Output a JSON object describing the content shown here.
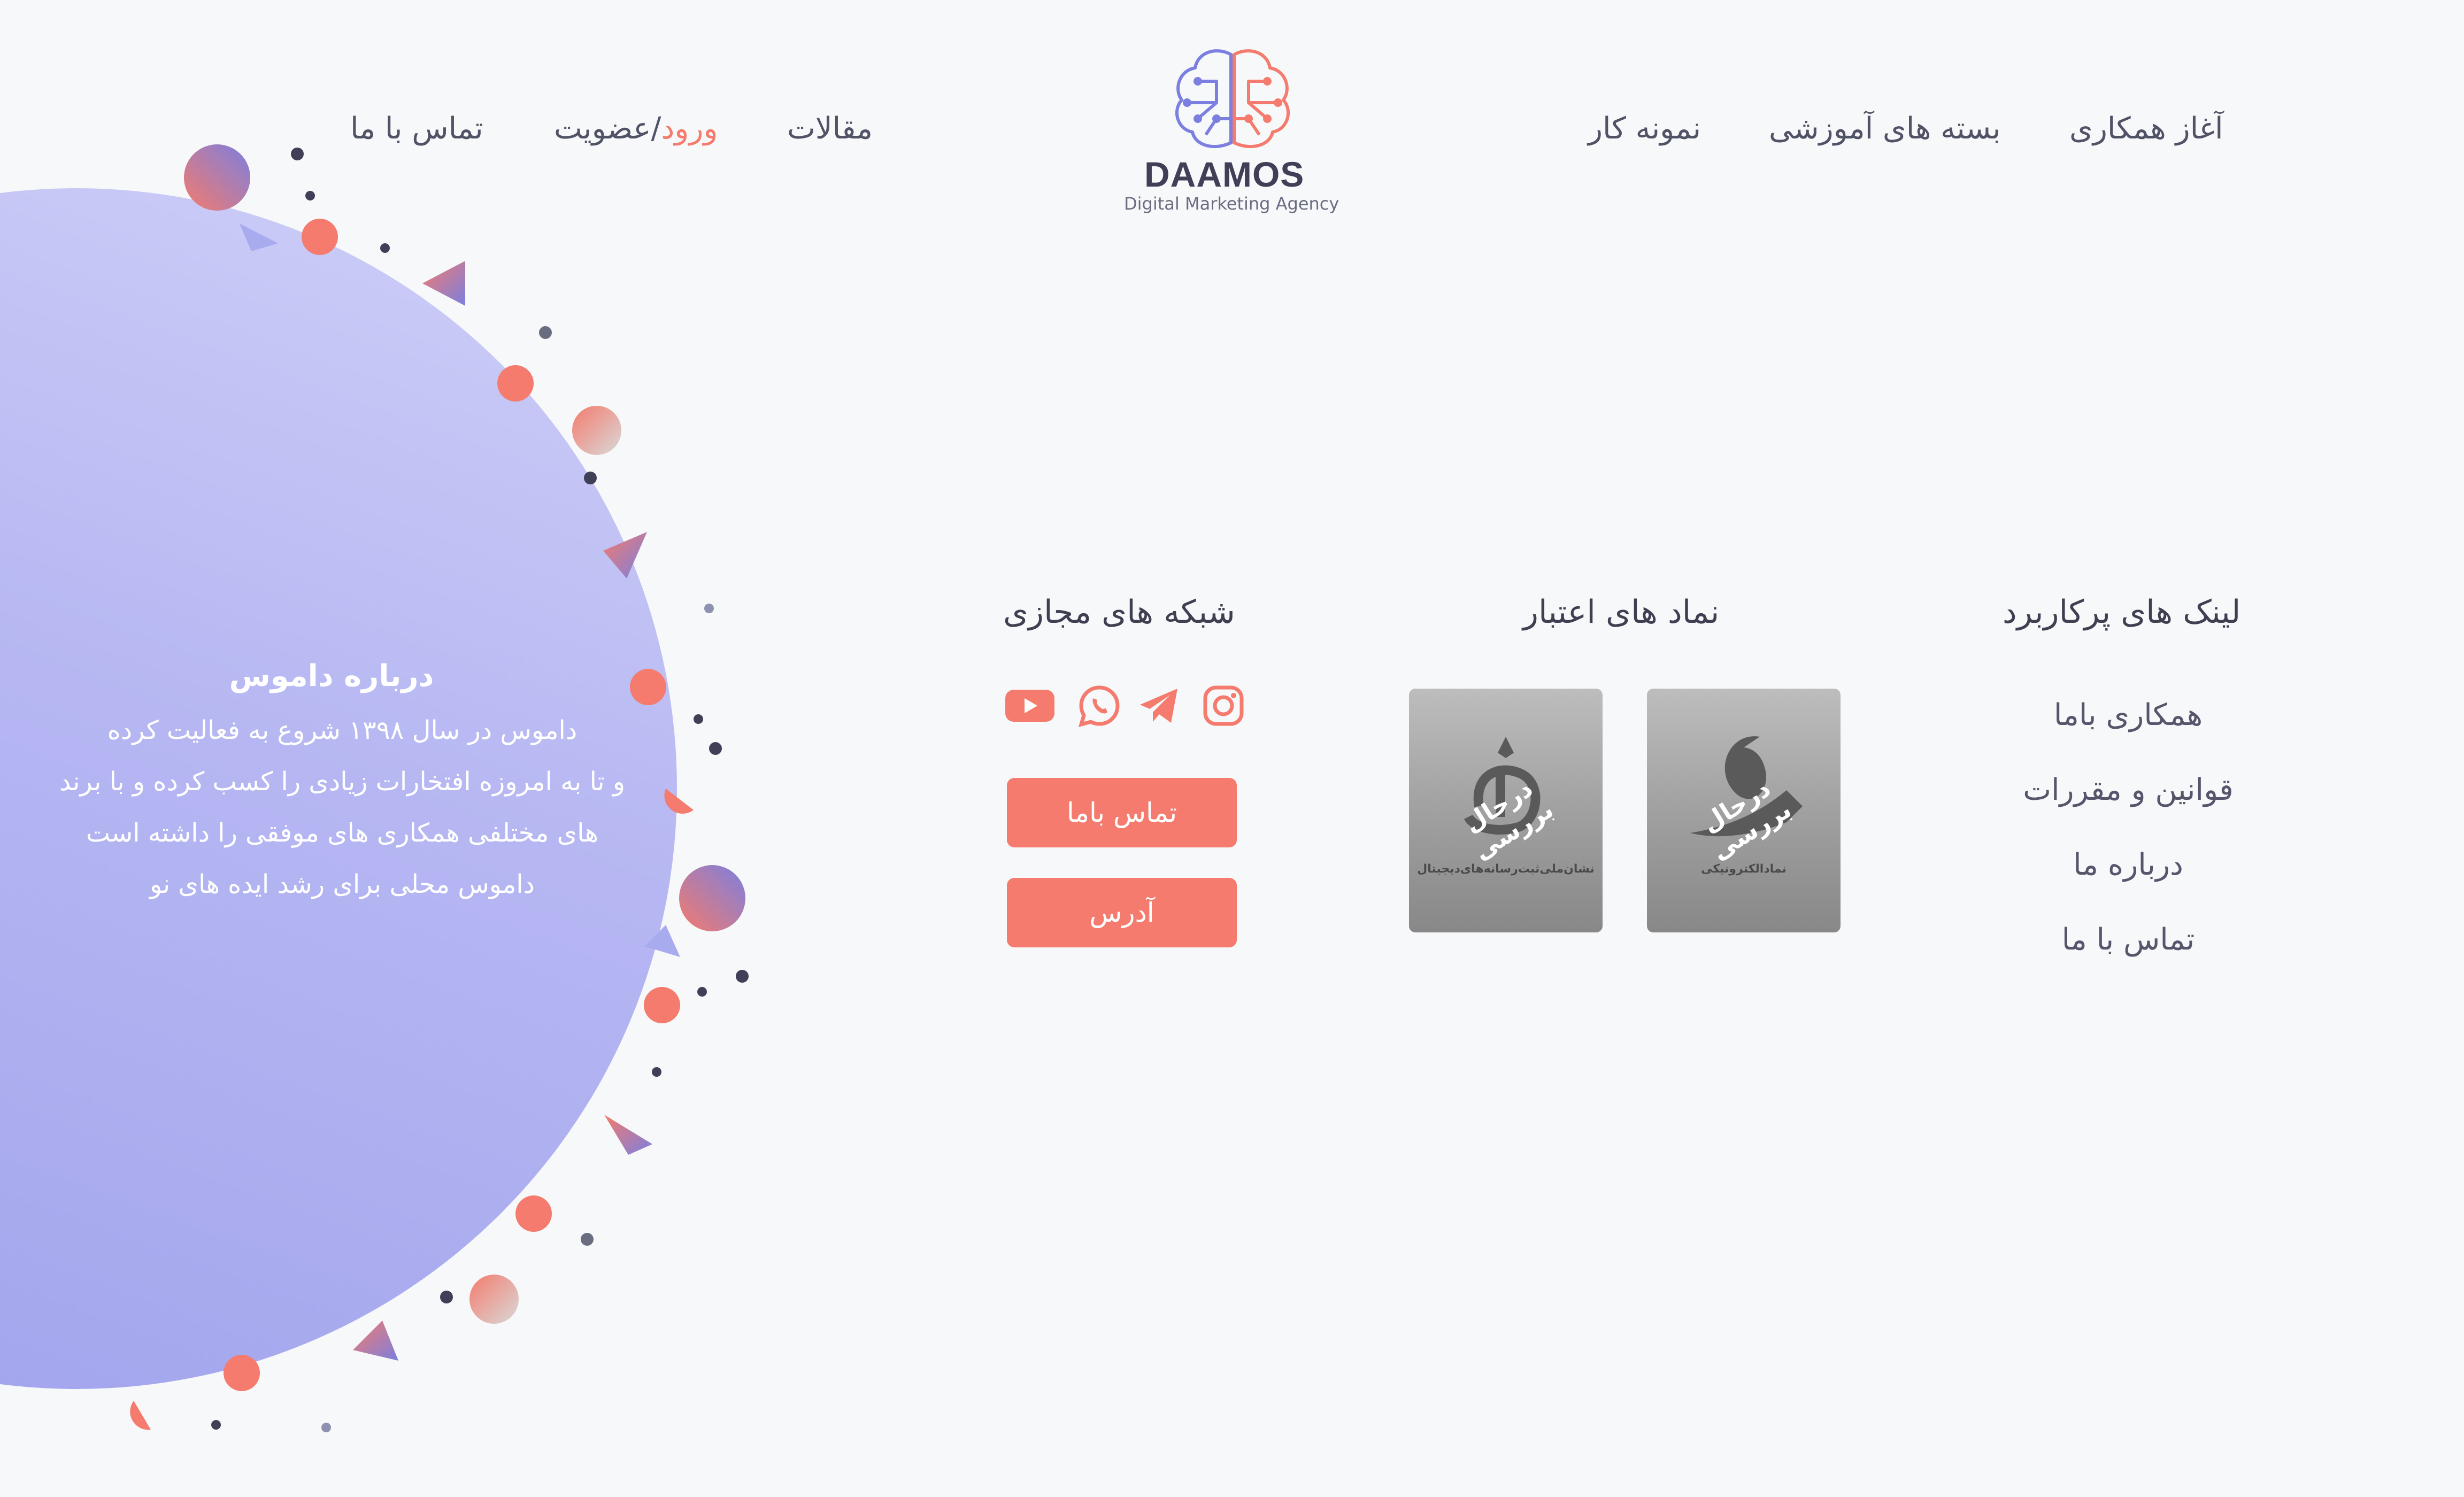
{
  "brand": {
    "name": "DAAMOS",
    "tagline": "Digital Marketing Agency"
  },
  "header_nav": {
    "start_collab": "آغاز همکاری",
    "packages": "بسته های آموزشی",
    "portfolio": "نمونه کار",
    "articles": "مقالات",
    "login": "ورود",
    "register": "/عضویت",
    "contact": "تماس با ما"
  },
  "about": {
    "title": "درباره داموس",
    "lines": [
      "داموس در سال ۱۳۹۸ شروع به فعالیت کرده",
      "و تا به امروزه افتخارات زیادی را کسب کرده و با برند",
      "های مختلفی همکاری های موفقی را داشته است",
      "داموس محلی برای رشد ایده های نو"
    ]
  },
  "social": {
    "title": "شبکه های مجازی",
    "icons": [
      "instagram-icon",
      "telegram-icon",
      "whatsapp-icon",
      "youtube-icon"
    ],
    "contact_button": "تماس باما",
    "address_button": "آدرس"
  },
  "trust": {
    "title": "نماد های اعتبار",
    "badges": [
      {
        "stamp": "درحال بررسی",
        "caption": "نمادالکترونیکی"
      },
      {
        "stamp": "درحال بررسی",
        "caption": "نشان‌ملی‌ثبت‌رسانه‌های‌دیجیتال"
      }
    ]
  },
  "useful_links": {
    "title": "لینک های پرکاربرد",
    "items": [
      "همکاری باما",
      "قوانین و مقررات",
      "درباره ما",
      "تماس با ما"
    ]
  },
  "colors": {
    "accent": "#f47b6d",
    "purple": "#7b7fe0",
    "text": "#55566b",
    "background": "#f7f8fa"
  }
}
